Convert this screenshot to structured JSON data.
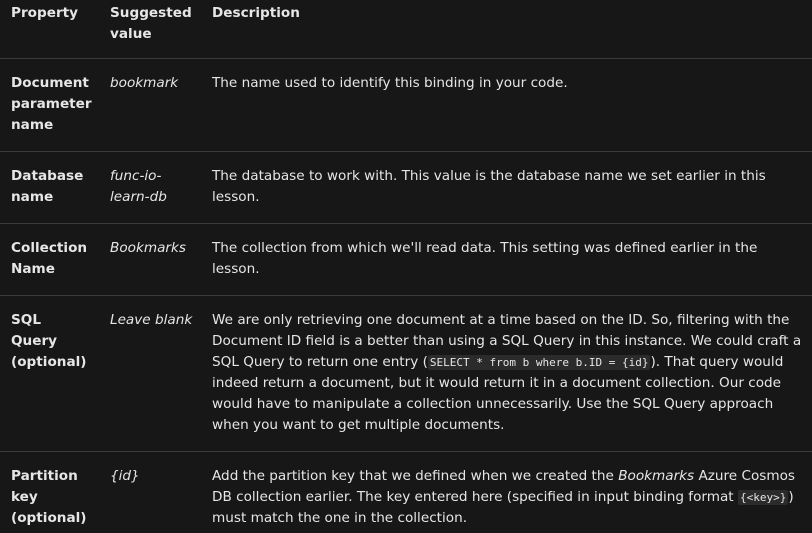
{
  "header": {
    "property": "Property",
    "suggested": "Suggested value",
    "description": "Description"
  },
  "rows": [
    {
      "property": "Document parameter name",
      "value": "bookmark",
      "description": "The name used to identify this binding in your code."
    },
    {
      "property": "Database name",
      "value": "func-io-learn-db",
      "description": "The database to work with. This value is the database name we set earlier in this lesson."
    },
    {
      "property": "Collection Name",
      "value": "Bookmarks",
      "description": "The collection from which we'll read data. This setting was defined earlier in the lesson."
    },
    {
      "property": "SQL Query (optional)",
      "value": "Leave blank",
      "desc_part1": "We are only retrieving one document at a time based on the ID. So, filtering with the Document ID field is a better than using a SQL Query in this instance. We could craft a SQL Query to return one entry (",
      "desc_code": "SELECT * from b where b.ID = {id}",
      "desc_part2": "). That query would indeed return a document, but it would return it in a document collection. Our code would have to manipulate a collection unnecessarily. Use the SQL Query approach when you want to get multiple documents."
    },
    {
      "property": "Partition key (optional)",
      "value": "{id}",
      "desc_part1": "Add the partition key that we defined when we created the ",
      "desc_em": "Bookmarks",
      "desc_part2": " Azure Cosmos DB collection earlier. The key entered here (specified in input binding format ",
      "desc_code": "{<key>}",
      "desc_part3": ") must match the one in the collection."
    }
  ]
}
